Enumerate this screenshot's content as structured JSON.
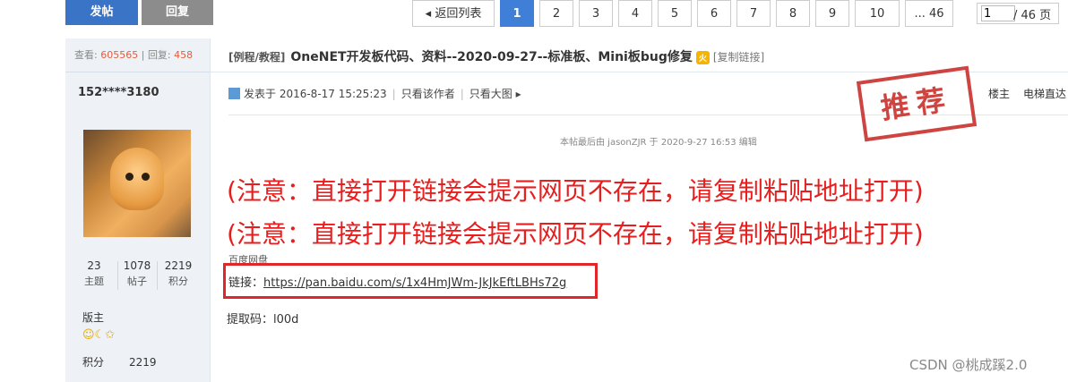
{
  "toolbar": {
    "post_label": "发帖",
    "reply_label": "回复"
  },
  "pagination": {
    "back_label": "◂ 返回列表",
    "pages": [
      "1",
      "2",
      "3",
      "4",
      "5",
      "6",
      "7",
      "8",
      "9",
      "10"
    ],
    "current": "1",
    "last_label": "... 46",
    "page_input_value": "1",
    "total_label": "/ 46 页"
  },
  "thread": {
    "views_label": "查看:",
    "views": "605565",
    "sep": "|",
    "replies_label": "回复:",
    "replies": "458",
    "category": "[例程/教程]",
    "title": "OneNET开发板代码、资料--2020-09-27--标准板、Mini板bug修复",
    "hot_badge": "火",
    "copy_link": "[复制链接]"
  },
  "author": {
    "username": "152****3180",
    "stats": [
      {
        "value": "23",
        "label": "主题"
      },
      {
        "value": "1078",
        "label": "帖子"
      },
      {
        "value": "2219",
        "label": "积分"
      }
    ],
    "role": "版主",
    "badges": "☺☾✩",
    "points_label": "积分",
    "points_value": "2219"
  },
  "post": {
    "posted_at": "发表于 2016-8-17 15:25:23",
    "only_author": "只看该作者",
    "only_images": "只看大图 ▸",
    "floor": "楼主",
    "elevator": "电梯直达",
    "stamp": "推荐",
    "edited_note": "本帖最后由 jasonZJR 于 2020-9-27 16:53 编辑",
    "notice_1": "(注意：直接打开链接会提示网页不存在，请复制粘贴地址打开)",
    "notice_2": "(注意：直接打开链接会提示网页不存在，请复制粘贴地址打开)",
    "baidu_label": "百度网盘",
    "link_label": "链接：",
    "link_url": "https://pan.baidu.com/s/1x4HmJWm-JkJkEftLBHs72g",
    "code_label": "提取码：l00d"
  },
  "watermark": "CSDN @桃成蹊2.0",
  "colors": {
    "accent": "#3f7fd8",
    "notice": "#e61e1e",
    "highlight_box": "#e0262b"
  }
}
